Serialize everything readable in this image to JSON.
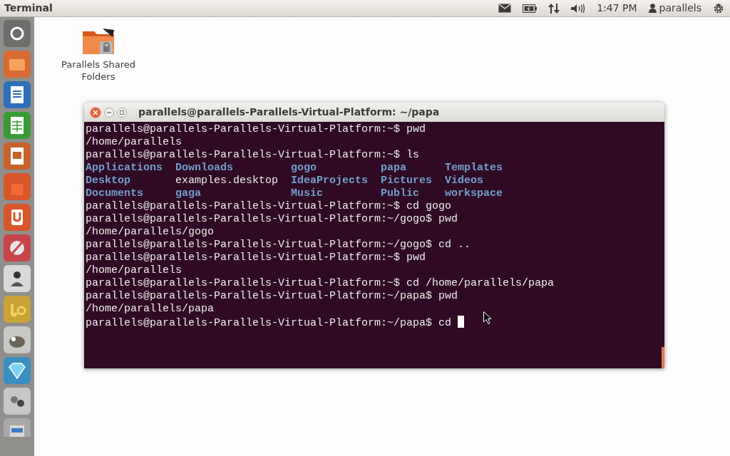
{
  "top_bar": {
    "app_title": "Terminal",
    "clock": "1:47 PM",
    "user": "parallels"
  },
  "desktop_icons": [
    {
      "label": "Parallels Shared Folders"
    }
  ],
  "terminal": {
    "title": "parallels@parallels-Parallels-Virtual-Platform: ~/papa",
    "lines": [
      {
        "kind": "text",
        "text": "parallels@parallels-Parallels-Virtual-Platform:~$ pwd"
      },
      {
        "kind": "text",
        "text": "/home/parallels"
      },
      {
        "kind": "text",
        "text": "parallels@parallels-Parallels-Virtual-Platform:~$ ls"
      },
      {
        "kind": "ls",
        "cells": [
          {
            "text": "Applications",
            "kind": "dir"
          },
          {
            "text": "Downloads",
            "kind": "dir"
          },
          {
            "text": "gogo",
            "kind": "dir"
          },
          {
            "text": "papa",
            "kind": "dir"
          },
          {
            "text": "Templates",
            "kind": "dir"
          }
        ]
      },
      {
        "kind": "ls",
        "cells": [
          {
            "text": "Desktop",
            "kind": "dir"
          },
          {
            "text": "examples.desktop",
            "kind": "file"
          },
          {
            "text": "IdeaProjects",
            "kind": "dir"
          },
          {
            "text": "Pictures",
            "kind": "dir"
          },
          {
            "text": "Videos",
            "kind": "dir"
          }
        ]
      },
      {
        "kind": "ls",
        "cells": [
          {
            "text": "Documents",
            "kind": "dir"
          },
          {
            "text": "gaga",
            "kind": "dir"
          },
          {
            "text": "Music",
            "kind": "dir"
          },
          {
            "text": "Public",
            "kind": "dir"
          },
          {
            "text": "workspace",
            "kind": "dir"
          }
        ]
      },
      {
        "kind": "text",
        "text": "parallels@parallels-Parallels-Virtual-Platform:~$ cd gogo"
      },
      {
        "kind": "text",
        "text": "parallels@parallels-Parallels-Virtual-Platform:~/gogo$ pwd"
      },
      {
        "kind": "text",
        "text": "/home/parallels/gogo"
      },
      {
        "kind": "text",
        "text": "parallels@parallels-Parallels-Virtual-Platform:~/gogo$ cd .."
      },
      {
        "kind": "text",
        "text": "parallels@parallels-Parallels-Virtual-Platform:~$ pwd"
      },
      {
        "kind": "text",
        "text": "/home/parallels"
      },
      {
        "kind": "text",
        "text": "parallels@parallels-Parallels-Virtual-Platform:~$ cd /home/parallels/papa"
      },
      {
        "kind": "text",
        "text": "parallels@parallels-Parallels-Virtual-Platform:~/papa$ pwd"
      },
      {
        "kind": "text",
        "text": "/home/parallels/papa"
      },
      {
        "kind": "prompt",
        "text": "parallels@parallels-Parallels-Virtual-Platform:~/papa$ cd "
      }
    ]
  }
}
